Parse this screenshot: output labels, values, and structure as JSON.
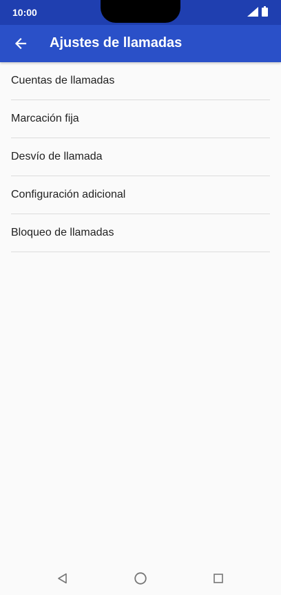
{
  "status_bar": {
    "time": "10:00",
    "signal_icon": "signal-icon",
    "battery_icon": "battery-icon"
  },
  "app_bar": {
    "back_icon": "arrow-back-icon",
    "title": "Ajustes de llamadas",
    "color": "#2a50c8",
    "status_color": "#1f3fb0"
  },
  "menu": {
    "items": [
      {
        "label": "Cuentas de llamadas"
      },
      {
        "label": "Marcación fija"
      },
      {
        "label": "Desvío de llamada"
      },
      {
        "label": "Configuración adicional"
      },
      {
        "label": "Bloqueo de llamadas"
      }
    ]
  },
  "nav_bar": {
    "back_icon": "nav-back-icon",
    "home_icon": "nav-home-icon",
    "recents_icon": "nav-recents-icon"
  }
}
